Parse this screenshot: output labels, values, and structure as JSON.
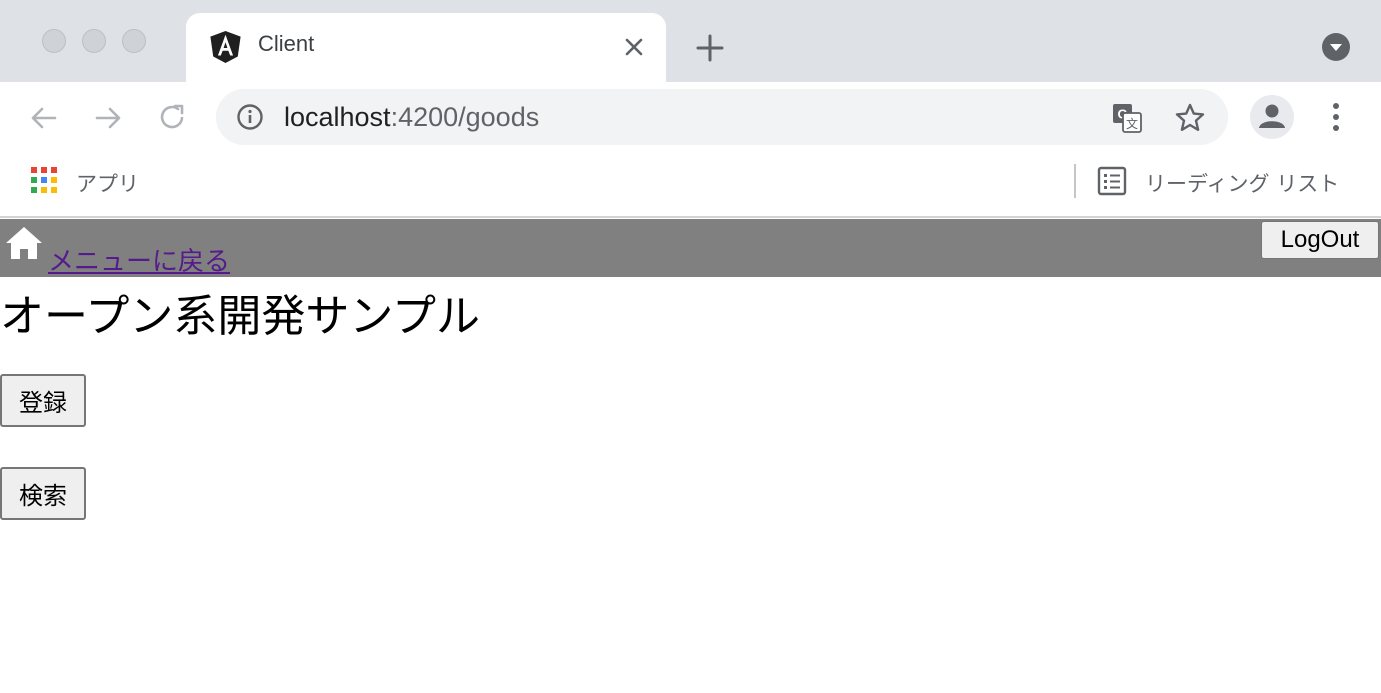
{
  "browser": {
    "tab": {
      "title": "Client",
      "favicon": "angular-logo-icon"
    },
    "address_bar": {
      "host": "localhost",
      "path": ":4200/goods"
    },
    "icons": [
      "info-icon",
      "translate-icon",
      "star-icon",
      "profile-icon",
      "more-vert-icon",
      "back-arrow-icon",
      "forward-arrow-icon",
      "reload-icon",
      "new-tab-plus-icon",
      "tab-search-icon",
      "close-icon"
    ],
    "bookmarks_bar": {
      "apps_label": "アプリ",
      "reading_list_label": "リーディング リスト"
    }
  },
  "page": {
    "header": {
      "home_icon": "home-icon",
      "menu_link": "メニューに戻る",
      "logout_label": "LogOut",
      "background_color": "#808080"
    },
    "title": "オープン系開発サンプル",
    "buttons": {
      "register_label": "登録",
      "search_label": "検索"
    }
  }
}
